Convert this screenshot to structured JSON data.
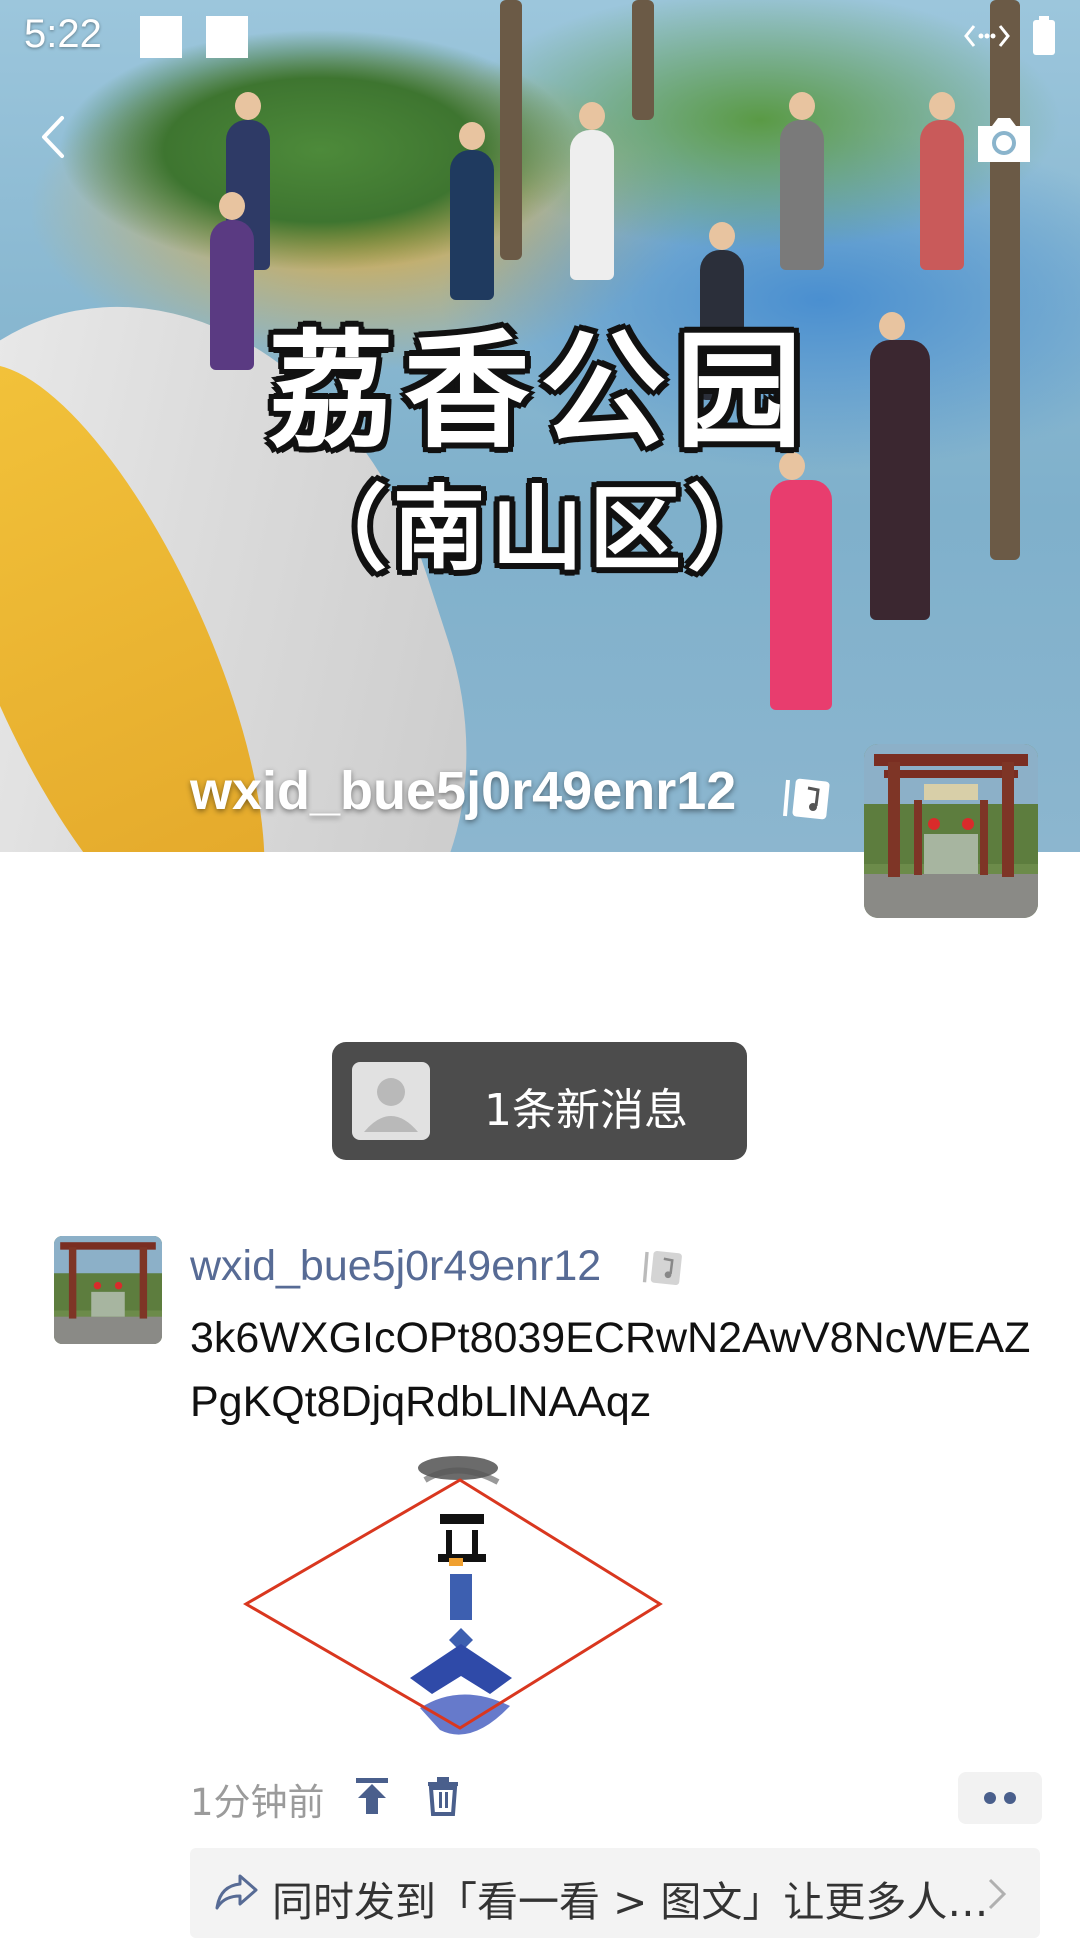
{
  "status_bar": {
    "time": "5:22",
    "icons": [
      "notification-square-icon",
      "notification-square-icon",
      "data-transfer-icon",
      "battery-icon"
    ]
  },
  "nav": {
    "back_icon": "chevron-left-icon",
    "camera_icon": "camera-icon"
  },
  "cover": {
    "title": "荔香公园",
    "subtitle": "（南山区）",
    "username": "wxid_bue5j0r49enr12",
    "badge_icon": "music-note-badge-icon"
  },
  "new_message": {
    "label": "1条新消息",
    "avatar_icon": "default-avatar-icon"
  },
  "post": {
    "author": "wxid_bue5j0r49enr12",
    "badge_icon": "music-note-badge-icon",
    "text": "3k6WXGIcOPt8039ECRwN2AwV8NcWEAZPgKQt8DjqRdbLlNAAqz",
    "time": "1分钟前",
    "pin_icon": "pin-to-top-icon",
    "delete_icon": "trash-icon",
    "more_icon": "more-dots-icon",
    "share": {
      "icon": "share-arrow-icon",
      "text": "同时发到「看一看 > 图文」让更多人…",
      "chevron_icon": "chevron-right-icon"
    }
  },
  "colors": {
    "link_blue": "#576b95",
    "pill_bg": "#4c4c4c",
    "diamond_red": "#d9371f",
    "meta_grey": "#9b9b9b"
  }
}
